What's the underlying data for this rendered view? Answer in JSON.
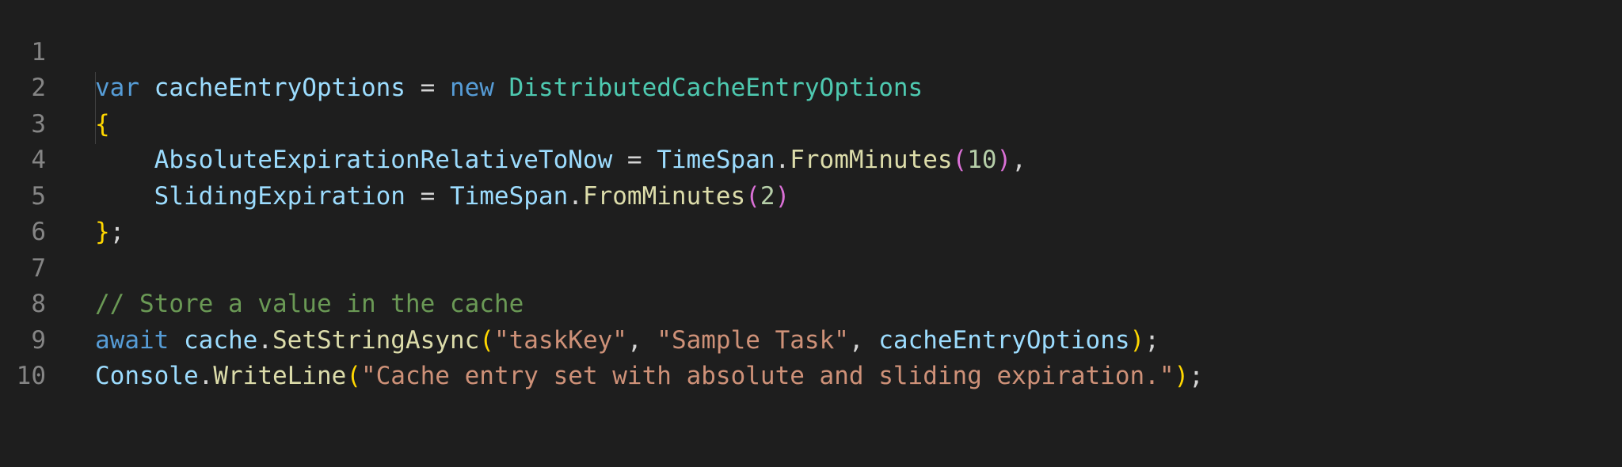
{
  "editor": {
    "line_numbers": [
      "1",
      "2",
      "3",
      "4",
      "5",
      "6",
      "7",
      "8",
      "9",
      "10"
    ],
    "line1": {
      "kw_var": "var",
      "name": "cacheEntryOptions",
      "eq": " = ",
      "kw_new": "new",
      "type": "DistributedCacheEntryOptions"
    },
    "line2": {
      "brace": "{"
    },
    "line3": {
      "prop": "AbsoluteExpirationRelativeToNow",
      "eq": " = ",
      "cls": "TimeSpan",
      "dot": ".",
      "fn": "FromMinutes",
      "open": "(",
      "num": "10",
      "close": ")",
      "comma": ","
    },
    "line4": {
      "prop": "SlidingExpiration",
      "eq": " = ",
      "cls": "TimeSpan",
      "dot": ".",
      "fn": "FromMinutes",
      "open": "(",
      "num": "2",
      "close": ")"
    },
    "line5": {
      "brace": "}",
      "semi": ";"
    },
    "line7": {
      "comment": "// Store a value in the cache"
    },
    "line8": {
      "kw_await": "await",
      "obj": "cache",
      "dot": ".",
      "fn": "SetStringAsync",
      "open": "(",
      "str1": "\"taskKey\"",
      "sep1": ", ",
      "str2": "\"Sample Task\"",
      "sep2": ", ",
      "arg": "cacheEntryOptions",
      "close": ")",
      "semi": ";"
    },
    "line9": {
      "cls": "Console",
      "dot": ".",
      "fn": "WriteLine",
      "open": "(",
      "str": "\"Cache entry set with absolute and sliding expiration.\"",
      "close": ")",
      "semi": ";"
    }
  }
}
